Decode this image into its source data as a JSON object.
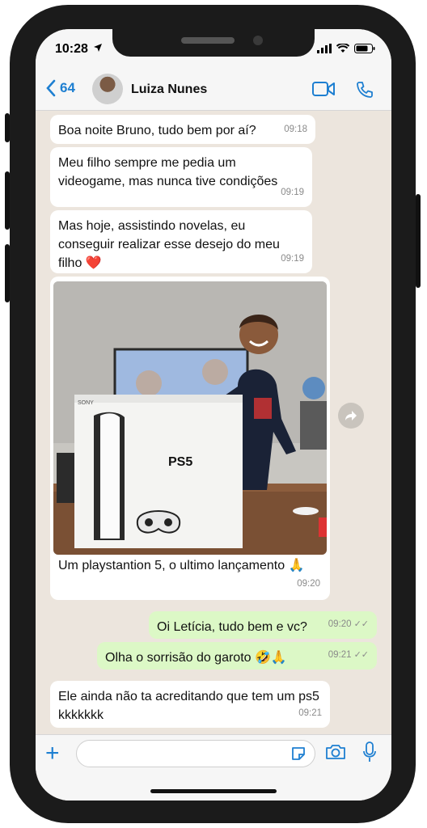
{
  "status": {
    "time": "10:28"
  },
  "header": {
    "back_count": "64",
    "contact_name": "Luiza Nunes"
  },
  "messages": [
    {
      "text": "Boa noite Bruno, tudo bem por aí?",
      "time": "09:18"
    },
    {
      "text": "Meu filho sempre me pedia um videogame, mas nunca tive condições",
      "time": "09:19"
    },
    {
      "text": "Mas hoje, assistindo novelas, eu conseguir realizar esse desejo do meu filho ❤️",
      "time": "09:19"
    },
    {
      "text": "Um playstantion 5, o ultimo lançamento 🙏",
      "time": "09:20"
    },
    {
      "text": "Oi Letícia, tudo bem e vc?",
      "time": "09:20"
    },
    {
      "text": "Olha o sorrisão do garoto 🤣🙏",
      "time": "09:21"
    },
    {
      "text": "Ele ainda não ta acreditando que tem um ps5 kkkkkkk",
      "time": "09:21"
    }
  ],
  "photo": {
    "box_brand": "SONY",
    "box_logo": "PS5"
  },
  "colors": {
    "accent": "#1e7fd1",
    "outgoing": "#dcf8c6",
    "incoming": "#ffffff",
    "chat_bg": "#ece5dd"
  },
  "icons": [
    "location-arrow-icon",
    "signal-icon",
    "wifi-icon",
    "battery-icon",
    "back-chevron-icon",
    "video-call-icon",
    "phone-icon",
    "share-icon",
    "plus-icon",
    "sticker-icon",
    "camera-icon",
    "microphone-icon"
  ]
}
